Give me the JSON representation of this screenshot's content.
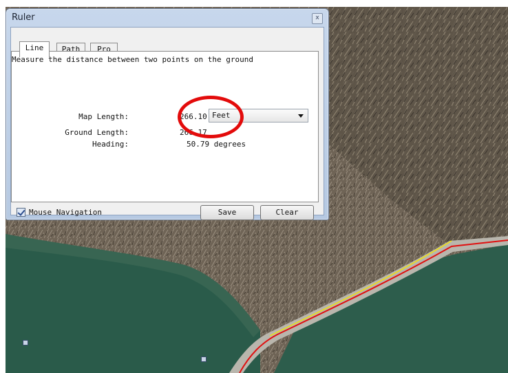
{
  "window": {
    "title": "Ruler",
    "close_label": "x"
  },
  "tabs": [
    {
      "label": "Line",
      "active": true
    },
    {
      "label": "Path",
      "active": false
    },
    {
      "label": "Pro",
      "active": false
    }
  ],
  "panel": {
    "description": "Measure the distance between two points on the ground",
    "map_length_label": "Map Length:",
    "map_length_value": "266.10",
    "unit_select": {
      "selected": "Feet"
    },
    "ground_length_label": "Ground Length:",
    "ground_length_value": "266.17",
    "heading_label": "Heading:",
    "heading_value": "50.79 degrees"
  },
  "footer": {
    "mouse_navigation_label": "Mouse Navigation",
    "mouse_navigation_checked": true,
    "save_label": "Save",
    "clear_label": "Clear"
  },
  "colors": {
    "highlight_circle": "#e30b0b",
    "measure_line": "#f2e20a",
    "path_line": "#e01010"
  },
  "icons": [
    "close-icon",
    "dropdown-arrow-icon",
    "checkbox-checked-icon",
    "placemark-icon"
  ]
}
